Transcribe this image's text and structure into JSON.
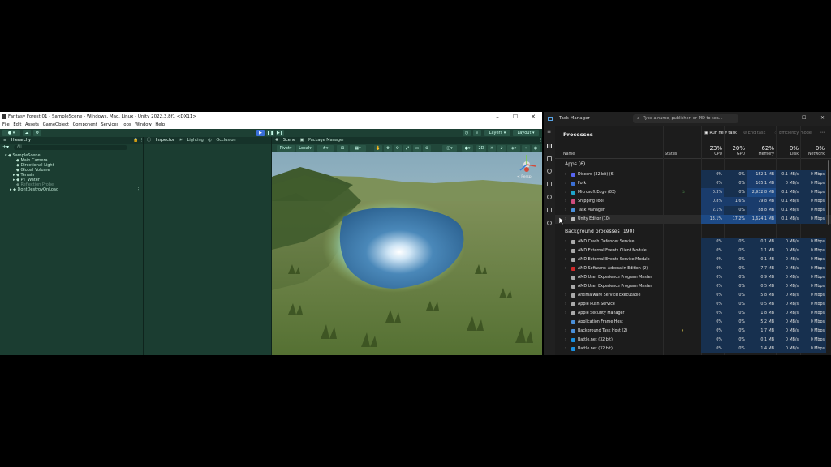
{
  "unity": {
    "title": "Fantasy Forest 01 - SampleScene - Windows, Mac, Linux - Unity 2022.3.8f1 <DX11>",
    "menu": [
      "File",
      "Edit",
      "Assets",
      "GameObject",
      "Component",
      "Services",
      "Jobs",
      "Window",
      "Help"
    ],
    "toolbar": {
      "layers": "Layers",
      "layout": "Layout"
    },
    "hierarchy": {
      "tab": "Hierarchy",
      "search_placeholder": "All",
      "items": [
        {
          "label": "SampleScene",
          "indent": 0,
          "dim": false
        },
        {
          "label": "Main Camera",
          "indent": 1,
          "dim": false
        },
        {
          "label": "Directional Light",
          "indent": 1,
          "dim": false
        },
        {
          "label": "Global Volume",
          "indent": 1,
          "dim": false
        },
        {
          "label": "Terrain",
          "indent": 1,
          "dim": false
        },
        {
          "label": "PT_Water",
          "indent": 1,
          "dim": false
        },
        {
          "label": "Reflection Probe",
          "indent": 1,
          "dim": true
        },
        {
          "label": "DontDestroyOnLoad",
          "indent": 0,
          "dim": false
        }
      ]
    },
    "inspector_tabs": [
      "Inspector",
      "Lighting",
      "Occlusion"
    ],
    "scene_tabs": [
      "Scene",
      "Package Manager"
    ],
    "scene_toolbar": {
      "pivot": "Pivot",
      "local": "Local"
    },
    "gizmo_label": "< Persp"
  },
  "taskmanager": {
    "title": "Task Manager",
    "search_placeholder": "Type a name, publisher, or PID to sea...",
    "page_title": "Processes",
    "actions": {
      "run_new_task": "Run new task",
      "end_task": "End task",
      "efficiency_mode": "Efficiency mode"
    },
    "columns": {
      "name": "Name",
      "status": "Status",
      "cpu": {
        "pct": "23%",
        "label": "CPU"
      },
      "gpu": {
        "pct": "20%",
        "label": "GPU"
      },
      "memory": {
        "pct": "62%",
        "label": "Memory"
      },
      "disk": {
        "pct": "0%",
        "label": "Disk"
      },
      "network": {
        "pct": "0%",
        "label": "Network"
      }
    },
    "apps_header": "Apps (6)",
    "apps": [
      {
        "name": "Discord (32 bit) (6)",
        "cpu": "0%",
        "gpu": "0%",
        "mem": "152.1 MB",
        "disk": "0.1 MB/s",
        "net": "0 Mbps",
        "color": "#5865f2"
      },
      {
        "name": "Fork",
        "cpu": "0%",
        "gpu": "0%",
        "mem": "105.1 MB",
        "disk": "0 MB/s",
        "net": "0 Mbps",
        "color": "#3b6fd4"
      },
      {
        "name": "Microsoft Edge (83)",
        "cpu": "0.3%",
        "gpu": "0%",
        "mem": "2,932.8 MB",
        "disk": "0.1 MB/s",
        "net": "0 Mbps",
        "color": "#1fa4c9"
      },
      {
        "name": "Snipping Tool",
        "cpu": "0.8%",
        "gpu": "1.6%",
        "mem": "79.8 MB",
        "disk": "0.1 MB/s",
        "net": "0 Mbps",
        "color": "#d04c7d"
      },
      {
        "name": "Task Manager",
        "cpu": "2.1%",
        "gpu": "0%",
        "mem": "88.8 MB",
        "disk": "0.1 MB/s",
        "net": "0 Mbps",
        "color": "#4a8fd9"
      },
      {
        "name": "Unity Editor (10)",
        "cpu": "13.1%",
        "gpu": "17.2%",
        "mem": "1,624.1 MB",
        "disk": "0.1 MB/s",
        "net": "0 Mbps",
        "color": "#bbbbbb"
      }
    ],
    "bg_header": "Background processes (190)",
    "background": [
      {
        "name": "AMD Crash Defender Service",
        "cpu": "0%",
        "gpu": "0%",
        "mem": "0.1 MB",
        "disk": "0 MB/s",
        "net": "0 Mbps",
        "color": "#aaaaaa"
      },
      {
        "name": "AMD External Events Client Module",
        "cpu": "0%",
        "gpu": "0%",
        "mem": "1.1 MB",
        "disk": "0 MB/s",
        "net": "0 Mbps",
        "color": "#aaaaaa"
      },
      {
        "name": "AMD External Events Service Module",
        "cpu": "0%",
        "gpu": "0%",
        "mem": "0.1 MB",
        "disk": "0 MB/s",
        "net": "0 Mbps",
        "color": "#aaaaaa"
      },
      {
        "name": "AMD Software: Adrenalin Edition (2)",
        "cpu": "0%",
        "gpu": "0%",
        "mem": "7.7 MB",
        "disk": "0 MB/s",
        "net": "0 Mbps",
        "color": "#d02a2a"
      },
      {
        "name": "AMD User Experience Program Master",
        "cpu": "0%",
        "gpu": "0%",
        "mem": "0.9 MB",
        "disk": "0 MB/s",
        "net": "0 Mbps",
        "color": "#aaaaaa"
      },
      {
        "name": "AMD User Experience Program Master",
        "cpu": "0%",
        "gpu": "0%",
        "mem": "0.5 MB",
        "disk": "0 MB/s",
        "net": "0 Mbps",
        "color": "#aaaaaa"
      },
      {
        "name": "Antimalware Service Executable",
        "cpu": "0%",
        "gpu": "0%",
        "mem": "5.8 MB",
        "disk": "0 MB/s",
        "net": "0 Mbps",
        "color": "#aaaaaa"
      },
      {
        "name": "Apple Push Service",
        "cpu": "0%",
        "gpu": "0%",
        "mem": "0.5 MB",
        "disk": "0 MB/s",
        "net": "0 Mbps",
        "color": "#aaaaaa"
      },
      {
        "name": "Apple Security Manager",
        "cpu": "0%",
        "gpu": "0%",
        "mem": "1.8 MB",
        "disk": "0 MB/s",
        "net": "0 Mbps",
        "color": "#aaaaaa"
      },
      {
        "name": "Application Frame Host",
        "cpu": "0%",
        "gpu": "0%",
        "mem": "5.2 MB",
        "disk": "0 MB/s",
        "net": "0 Mbps",
        "color": "#4a8fd9"
      },
      {
        "name": "Background Task Host (2)",
        "cpu": "0%",
        "gpu": "0%",
        "mem": "1.7 MB",
        "disk": "0 MB/s",
        "net": "0 Mbps",
        "color": "#4a8fd9"
      },
      {
        "name": "Battle.net (32 bit)",
        "cpu": "0%",
        "gpu": "0%",
        "mem": "0.1 MB",
        "disk": "0 MB/s",
        "net": "0 Mbps",
        "color": "#1a8fe0"
      },
      {
        "name": "Battle.net (32 bit)",
        "cpu": "0%",
        "gpu": "0%",
        "mem": "1.4 MB",
        "disk": "0 MB/s",
        "net": "0 Mbps",
        "color": "#1a8fe0"
      }
    ]
  }
}
